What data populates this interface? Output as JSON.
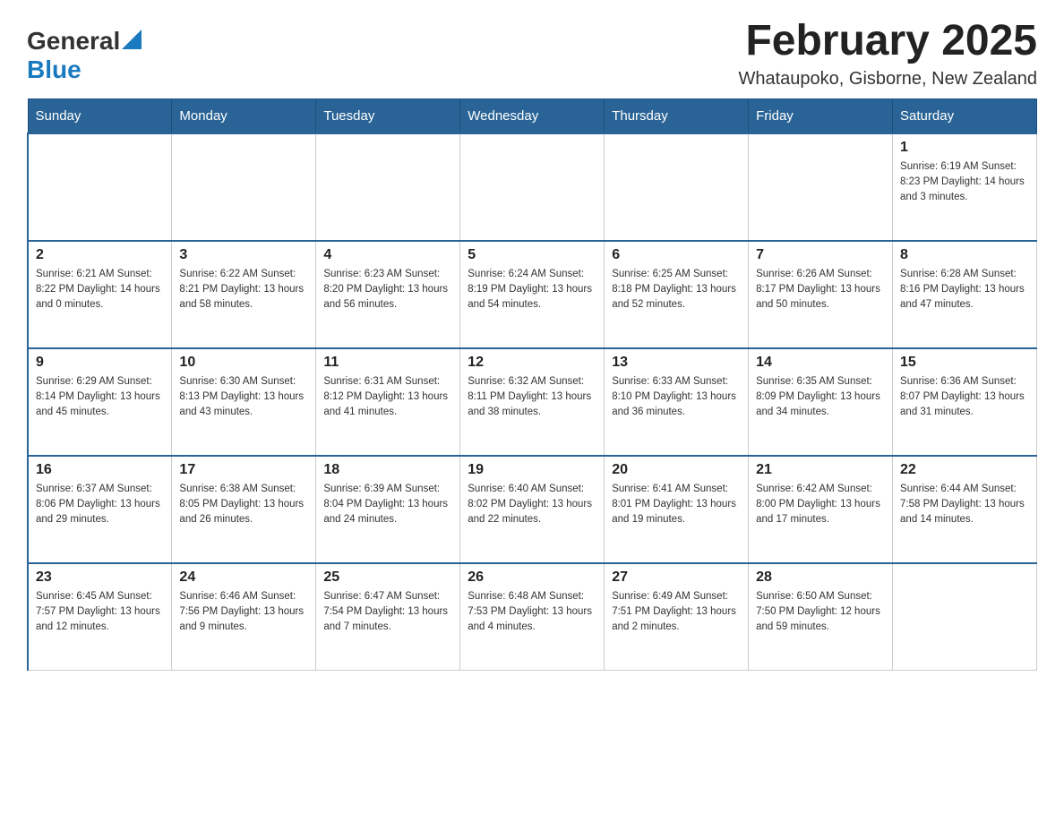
{
  "header": {
    "logo_general": "General",
    "logo_blue": "Blue",
    "month_title": "February 2025",
    "location": "Whataupoko, Gisborne, New Zealand"
  },
  "days_of_week": [
    "Sunday",
    "Monday",
    "Tuesday",
    "Wednesday",
    "Thursday",
    "Friday",
    "Saturday"
  ],
  "weeks": [
    [
      {
        "day": "",
        "info": ""
      },
      {
        "day": "",
        "info": ""
      },
      {
        "day": "",
        "info": ""
      },
      {
        "day": "",
        "info": ""
      },
      {
        "day": "",
        "info": ""
      },
      {
        "day": "",
        "info": ""
      },
      {
        "day": "1",
        "info": "Sunrise: 6:19 AM\nSunset: 8:23 PM\nDaylight: 14 hours and 3 minutes."
      }
    ],
    [
      {
        "day": "2",
        "info": "Sunrise: 6:21 AM\nSunset: 8:22 PM\nDaylight: 14 hours and 0 minutes."
      },
      {
        "day": "3",
        "info": "Sunrise: 6:22 AM\nSunset: 8:21 PM\nDaylight: 13 hours and 58 minutes."
      },
      {
        "day": "4",
        "info": "Sunrise: 6:23 AM\nSunset: 8:20 PM\nDaylight: 13 hours and 56 minutes."
      },
      {
        "day": "5",
        "info": "Sunrise: 6:24 AM\nSunset: 8:19 PM\nDaylight: 13 hours and 54 minutes."
      },
      {
        "day": "6",
        "info": "Sunrise: 6:25 AM\nSunset: 8:18 PM\nDaylight: 13 hours and 52 minutes."
      },
      {
        "day": "7",
        "info": "Sunrise: 6:26 AM\nSunset: 8:17 PM\nDaylight: 13 hours and 50 minutes."
      },
      {
        "day": "8",
        "info": "Sunrise: 6:28 AM\nSunset: 8:16 PM\nDaylight: 13 hours and 47 minutes."
      }
    ],
    [
      {
        "day": "9",
        "info": "Sunrise: 6:29 AM\nSunset: 8:14 PM\nDaylight: 13 hours and 45 minutes."
      },
      {
        "day": "10",
        "info": "Sunrise: 6:30 AM\nSunset: 8:13 PM\nDaylight: 13 hours and 43 minutes."
      },
      {
        "day": "11",
        "info": "Sunrise: 6:31 AM\nSunset: 8:12 PM\nDaylight: 13 hours and 41 minutes."
      },
      {
        "day": "12",
        "info": "Sunrise: 6:32 AM\nSunset: 8:11 PM\nDaylight: 13 hours and 38 minutes."
      },
      {
        "day": "13",
        "info": "Sunrise: 6:33 AM\nSunset: 8:10 PM\nDaylight: 13 hours and 36 minutes."
      },
      {
        "day": "14",
        "info": "Sunrise: 6:35 AM\nSunset: 8:09 PM\nDaylight: 13 hours and 34 minutes."
      },
      {
        "day": "15",
        "info": "Sunrise: 6:36 AM\nSunset: 8:07 PM\nDaylight: 13 hours and 31 minutes."
      }
    ],
    [
      {
        "day": "16",
        "info": "Sunrise: 6:37 AM\nSunset: 8:06 PM\nDaylight: 13 hours and 29 minutes."
      },
      {
        "day": "17",
        "info": "Sunrise: 6:38 AM\nSunset: 8:05 PM\nDaylight: 13 hours and 26 minutes."
      },
      {
        "day": "18",
        "info": "Sunrise: 6:39 AM\nSunset: 8:04 PM\nDaylight: 13 hours and 24 minutes."
      },
      {
        "day": "19",
        "info": "Sunrise: 6:40 AM\nSunset: 8:02 PM\nDaylight: 13 hours and 22 minutes."
      },
      {
        "day": "20",
        "info": "Sunrise: 6:41 AM\nSunset: 8:01 PM\nDaylight: 13 hours and 19 minutes."
      },
      {
        "day": "21",
        "info": "Sunrise: 6:42 AM\nSunset: 8:00 PM\nDaylight: 13 hours and 17 minutes."
      },
      {
        "day": "22",
        "info": "Sunrise: 6:44 AM\nSunset: 7:58 PM\nDaylight: 13 hours and 14 minutes."
      }
    ],
    [
      {
        "day": "23",
        "info": "Sunrise: 6:45 AM\nSunset: 7:57 PM\nDaylight: 13 hours and 12 minutes."
      },
      {
        "day": "24",
        "info": "Sunrise: 6:46 AM\nSunset: 7:56 PM\nDaylight: 13 hours and 9 minutes."
      },
      {
        "day": "25",
        "info": "Sunrise: 6:47 AM\nSunset: 7:54 PM\nDaylight: 13 hours and 7 minutes."
      },
      {
        "day": "26",
        "info": "Sunrise: 6:48 AM\nSunset: 7:53 PM\nDaylight: 13 hours and 4 minutes."
      },
      {
        "day": "27",
        "info": "Sunrise: 6:49 AM\nSunset: 7:51 PM\nDaylight: 13 hours and 2 minutes."
      },
      {
        "day": "28",
        "info": "Sunrise: 6:50 AM\nSunset: 7:50 PM\nDaylight: 12 hours and 59 minutes."
      },
      {
        "day": "",
        "info": ""
      }
    ]
  ]
}
